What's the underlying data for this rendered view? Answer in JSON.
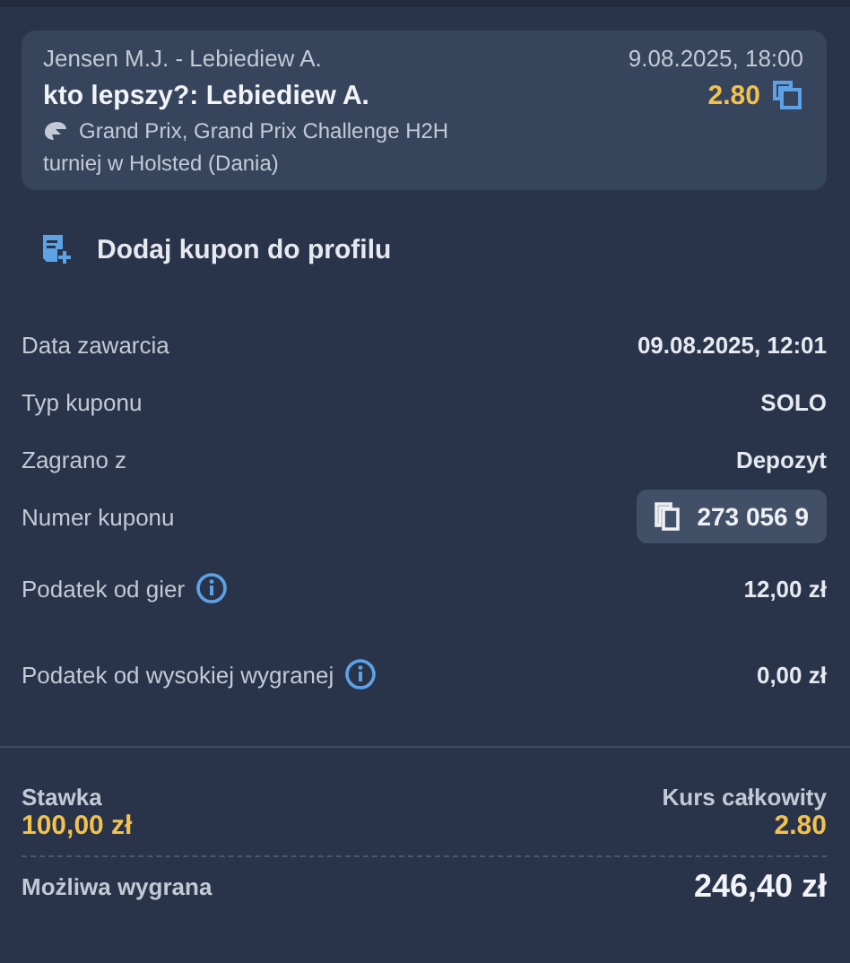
{
  "event": {
    "teams": "Jensen M.J. - Lebiediew A.",
    "datetime": "9.08.2025, 18:00",
    "pick": "kto lepszy?: Lebiediew A.",
    "odds": "2.80",
    "competition": "Grand Prix, Grand Prix Challenge H2H",
    "tournament": "turniej w Holsted (Dania)"
  },
  "add_coupon": {
    "label": "Dodaj kupon do profilu"
  },
  "details": [
    {
      "kind": "plain",
      "label": "Data zawarcia",
      "value": "09.08.2025, 12:01"
    },
    {
      "kind": "plain",
      "label": "Typ kuponu",
      "value": "SOLO"
    },
    {
      "kind": "plain",
      "label": "Zagrano z",
      "value": "Depozyt"
    },
    {
      "kind": "copy",
      "label": "Numer kuponu",
      "value": "273 056 9"
    },
    {
      "kind": "info",
      "label": "Podatek od gier",
      "value": "12,00 zł"
    },
    {
      "kind": "info",
      "label": "Podatek od wysokiej wygranej",
      "value": "0,00 zł"
    }
  ],
  "summary": {
    "stake_label": "Stawka",
    "stake": "100,00 zł",
    "total_odds_label": "Kurs całkowity",
    "total_odds": "2.80",
    "win_label": "Możliwa wygrana",
    "win": "246,40 zł"
  }
}
